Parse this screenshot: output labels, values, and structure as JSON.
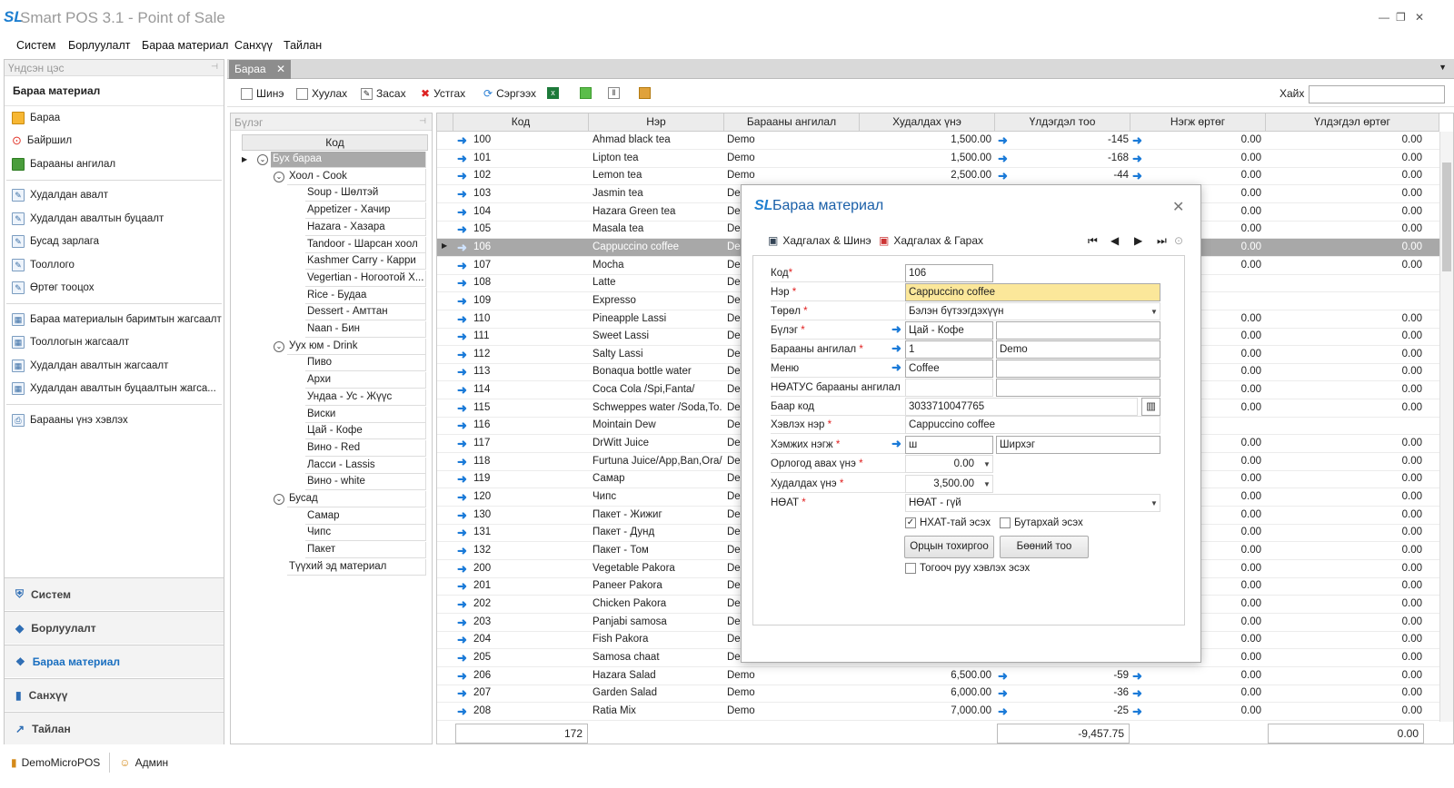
{
  "app": {
    "logo": "SL",
    "title": "Smart POS 3.1 - Point of Sale"
  },
  "menu": [
    "Систем",
    "Борлуулалт",
    "Бараа материал",
    "Санхүү",
    "Тайлан"
  ],
  "leftnav": {
    "header": "Үндсэн цэс",
    "group_title": "Бараа материал",
    "items": [
      "Бараа",
      "Байршил",
      "Барааны ангилал",
      "Худалдан авалт",
      "Худалдан авалтын буцаалт",
      "Бусад зарлага",
      "Тооллого",
      "Өртөг тооцох",
      "Бараа материалын баримтын жагсаалт",
      "Тооллогын жагсаалт",
      "Худалдан авалтын жагсаалт",
      "Худалдан авалтын буцаалтын жагса...",
      "Барааны үнэ хэвлэх"
    ],
    "bottom": [
      "Систем",
      "Борлуулалт",
      "Бараа материал",
      "Санхүү",
      "Тайлан"
    ]
  },
  "status": {
    "db": "DemoMicroPOS",
    "user": "Админ"
  },
  "tab": {
    "label": "Бараа"
  },
  "toolbar": {
    "new": "Шинэ",
    "copy": "Хуулах",
    "edit": "Засах",
    "delete": "Устгах",
    "refresh": "Сэргээх",
    "search_label": "Хайх",
    "search_value": ""
  },
  "groups": {
    "header": "Бүлэг",
    "column": "Код",
    "nodes": [
      "Бух бараа",
      "Хоол - Cook",
      "Soup - Шөлтэй",
      "Appetizer - Хачир",
      "Hazara - Хазара",
      "Tandoor - Шарсан хоол",
      "Kashmer Carry - Карри",
      "Vegertian - Ногоотой Х...",
      "Rice - Будаа",
      "Dessert - Амттан",
      "Naan - Бин",
      "Уух юм - Drink",
      "Пиво",
      "Архи",
      "Ундаа - Ус - Жүүс",
      "Виски",
      "Цай - Кофе",
      "Вино - Red",
      "Ласси - Lassis",
      "Вино - white",
      "Бусад",
      "Самар",
      "Чипс",
      "Пакет",
      "Түүхий эд материал"
    ]
  },
  "grid": {
    "columns": [
      "Код",
      "Нэр",
      "Барааны ангилал",
      "Худалдах үнэ",
      "Үлдэгдэл тоо",
      "Нэгж өртөг",
      "Үлдэгдэл өртөг"
    ],
    "rows": [
      {
        "code": "100",
        "name": "Ahmad black tea",
        "cat": "Demo",
        "price": "1,500.00",
        "qty": "-145",
        "unit": "0.00",
        "total": "0.00"
      },
      {
        "code": "101",
        "name": "Lipton tea",
        "cat": "Demo",
        "price": "1,500.00",
        "qty": "-168",
        "unit": "0.00",
        "total": "0.00"
      },
      {
        "code": "102",
        "name": "Lemon tea",
        "cat": "Demo",
        "price": "2,500.00",
        "qty": "-44",
        "unit": "0.00",
        "total": "0.00"
      },
      {
        "code": "103",
        "name": "Jasmin tea",
        "cat": "De",
        "price": "",
        "qty": "",
        "unit": "0.00",
        "total": "0.00"
      },
      {
        "code": "104",
        "name": "Hazara Green tea",
        "cat": "De",
        "price": "",
        "qty": "",
        "unit": "0.00",
        "total": "0.00"
      },
      {
        "code": "105",
        "name": "Masala tea",
        "cat": "De",
        "price": "",
        "qty": "",
        "unit": "0.00",
        "total": "0.00"
      },
      {
        "code": "106",
        "name": "Cappuccino coffee",
        "cat": "De",
        "price": "",
        "qty": "",
        "unit": "0.00",
        "total": "0.00"
      },
      {
        "code": "107",
        "name": "Mocha",
        "cat": "De",
        "price": "",
        "qty": "",
        "unit": "0.00",
        "total": "0.00"
      },
      {
        "code": "108",
        "name": "Latte",
        "cat": "De",
        "price": "",
        "qty": "",
        "unit": "",
        "total": ""
      },
      {
        "code": "109",
        "name": "Expresso",
        "cat": "De",
        "price": "",
        "qty": "",
        "unit": "",
        "total": ""
      },
      {
        "code": "110",
        "name": "Pineapple Lassi",
        "cat": "De",
        "price": "",
        "qty": "",
        "unit": "0.00",
        "total": "0.00"
      },
      {
        "code": "111",
        "name": "Sweet Lassi",
        "cat": "De",
        "price": "",
        "qty": "",
        "unit": "0.00",
        "total": "0.00"
      },
      {
        "code": "112",
        "name": "Salty Lassi",
        "cat": "De",
        "price": "",
        "qty": "",
        "unit": "0.00",
        "total": "0.00"
      },
      {
        "code": "113",
        "name": "Bonaqua bottle water",
        "cat": "De",
        "price": "",
        "qty": "",
        "unit": "0.00",
        "total": "0.00"
      },
      {
        "code": "114",
        "name": "Coca Cola /Spi,Fanta/",
        "cat": "De",
        "price": "",
        "qty": "",
        "unit": "0.00",
        "total": "0.00"
      },
      {
        "code": "115",
        "name": "Schweppes water /Soda,To...",
        "cat": "De",
        "price": "",
        "qty": "",
        "unit": "0.00",
        "total": "0.00"
      },
      {
        "code": "116",
        "name": "Mointain Dew",
        "cat": "De",
        "price": "",
        "qty": "",
        "unit": "",
        "total": ""
      },
      {
        "code": "117",
        "name": "DrWitt Juice",
        "cat": "De",
        "price": "",
        "qty": "",
        "unit": "0.00",
        "total": "0.00"
      },
      {
        "code": "118",
        "name": "Furtuna Juice/App,Ban,Ora/",
        "cat": "De",
        "price": "",
        "qty": "",
        "unit": "0.00",
        "total": "0.00"
      },
      {
        "code": "119",
        "name": "Самар",
        "cat": "De",
        "price": "",
        "qty": "",
        "unit": "0.00",
        "total": "0.00"
      },
      {
        "code": "120",
        "name": "Чипс",
        "cat": "De",
        "price": "",
        "qty": "",
        "unit": "0.00",
        "total": "0.00"
      },
      {
        "code": "130",
        "name": "Пакет - Жижиг",
        "cat": "De",
        "price": "",
        "qty": "",
        "unit": "0.00",
        "total": "0.00"
      },
      {
        "code": "131",
        "name": "Пакет - Дунд",
        "cat": "De",
        "price": "",
        "qty": "",
        "unit": "0.00",
        "total": "0.00"
      },
      {
        "code": "132",
        "name": "Пакет - Том",
        "cat": "De",
        "price": "",
        "qty": "",
        "unit": "0.00",
        "total": "0.00"
      },
      {
        "code": "200",
        "name": "Vegetable Pakora",
        "cat": "De",
        "price": "",
        "qty": "",
        "unit": "0.00",
        "total": "0.00"
      },
      {
        "code": "201",
        "name": "Paneer Pakora",
        "cat": "De",
        "price": "",
        "qty": "",
        "unit": "0.00",
        "total": "0.00"
      },
      {
        "code": "202",
        "name": "Chicken Pakora",
        "cat": "De",
        "price": "",
        "qty": "",
        "unit": "0.00",
        "total": "0.00"
      },
      {
        "code": "203",
        "name": "Panjabi samosa",
        "cat": "De",
        "price": "",
        "qty": "",
        "unit": "0.00",
        "total": "0.00"
      },
      {
        "code": "204",
        "name": "Fish Pakora",
        "cat": "De",
        "price": "",
        "qty": "",
        "unit": "0.00",
        "total": "0.00"
      },
      {
        "code": "205",
        "name": "Samosa chaat",
        "cat": "De",
        "price": "",
        "qty": "",
        "unit": "0.00",
        "total": "0.00"
      },
      {
        "code": "206",
        "name": "Hazara Salad",
        "cat": "Demo",
        "price": "6,500.00",
        "qty": "-59",
        "unit": "0.00",
        "total": "0.00"
      },
      {
        "code": "207",
        "name": "Garden Salad",
        "cat": "Demo",
        "price": "6,000.00",
        "qty": "-36",
        "unit": "0.00",
        "total": "0.00"
      },
      {
        "code": "208",
        "name": "Ratia Mix",
        "cat": "Demo",
        "price": "7,000.00",
        "qty": "-25",
        "unit": "0.00",
        "total": "0.00"
      }
    ],
    "footer": {
      "count": "172",
      "qty_sum": "-9,457.75",
      "cost_sum": "0.00"
    }
  },
  "dialog": {
    "title": "Бараа материал",
    "save_new": "Хадгалах & Шинэ",
    "save_exit": "Хадгалах & Гарах",
    "labels": {
      "code": "Код",
      "name": "Нэр",
      "type": "Төрөл",
      "group": "Бүлэг",
      "category": "Барааны ангилал",
      "menu": "Меню",
      "vat_cat": "НӨАТУС барааны ангилал",
      "barcode": "Баар код",
      "print_name": "Хэвлэх нэр",
      "unit": "Хэмжих нэгж",
      "cost": "Орлогод авах үнэ",
      "price": "Худалдах үнэ",
      "vat": "НӨАТ"
    },
    "values": {
      "code": "106",
      "name": "Cappuccino coffee",
      "type": "Бэлэн бүтээгдэхүүн",
      "group": "Цай - Кофе",
      "category_code": "1",
      "category_name": "Demo",
      "menu": "Coffee",
      "barcode": "3033710047765",
      "print_name": "Cappuccino coffee",
      "unit": "ш",
      "unit_name": "Ширхэг",
      "cost": "0.00",
      "price": "3,500.00",
      "vat": "НӨАТ - гүй"
    },
    "checkboxes": {
      "nhat": "НХАТ-тай эсэх",
      "bundle": "Бутархай эсэх",
      "kitchen": "Тогооч руу хэвлэх эсэх"
    },
    "buttons": {
      "area": "Орцын тохиргоо",
      "bulk": "Бөөний тоо"
    }
  }
}
